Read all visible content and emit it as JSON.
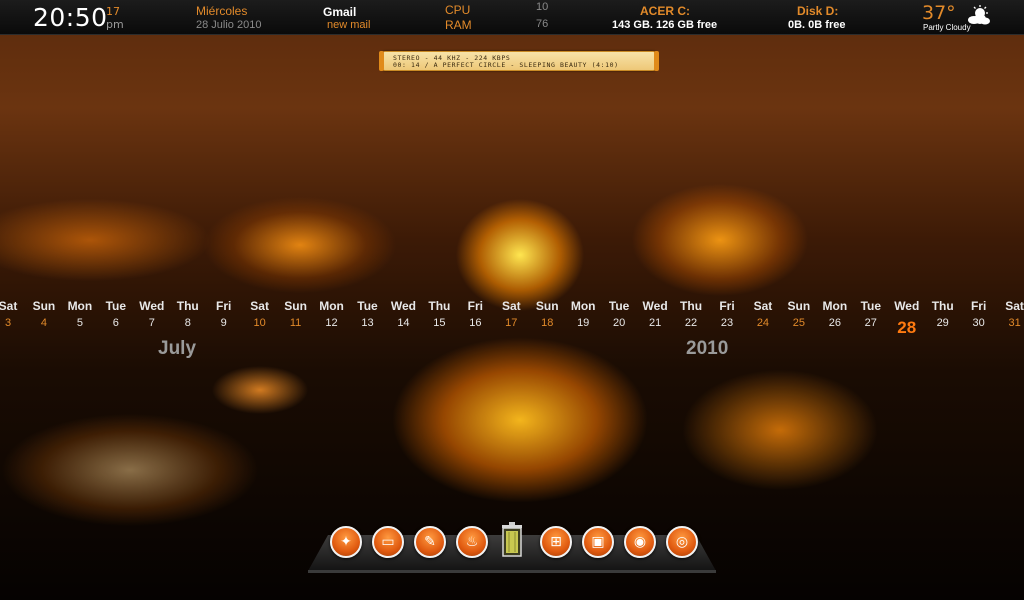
{
  "topbar": {
    "time": "20:50",
    "seconds": "17",
    "ampm": "pm",
    "day_name": "Miércoles",
    "date": "28 Julio 2010",
    "gmail_title": "Gmail",
    "gmail_status": "new mail",
    "cpu_label": "CPU",
    "cpu_value": "10",
    "ram_label": "RAM",
    "ram_value": "76",
    "acer_title": "ACER C:",
    "acer_info": "143 GB. 126 GB free",
    "diskd_title": "Disk D:",
    "diskd_info": "0B. 0B free",
    "temperature": "37°",
    "condition": "Partly Cloudy",
    "weather_icon": "partly-cloudy-icon"
  },
  "player": {
    "line1": "STEREO - 44 KHZ - 224 KBPS",
    "line2": "00: 14 / A PERFECT CIRCLE - SLEEPING BEAUTY (4:10)"
  },
  "calendar": {
    "month": "July",
    "year": "2010",
    "days": [
      {
        "name": "Sat",
        "num": "3",
        "weekend": true
      },
      {
        "name": "Sun",
        "num": "4",
        "weekend": true
      },
      {
        "name": "Mon",
        "num": "5"
      },
      {
        "name": "Tue",
        "num": "6"
      },
      {
        "name": "Wed",
        "num": "7"
      },
      {
        "name": "Thu",
        "num": "8"
      },
      {
        "name": "Fri",
        "num": "9"
      },
      {
        "name": "Sat",
        "num": "10",
        "weekend": true
      },
      {
        "name": "Sun",
        "num": "11",
        "weekend": true
      },
      {
        "name": "Mon",
        "num": "12"
      },
      {
        "name": "Tue",
        "num": "13"
      },
      {
        "name": "Wed",
        "num": "14"
      },
      {
        "name": "Thu",
        "num": "15"
      },
      {
        "name": "Fri",
        "num": "16"
      },
      {
        "name": "Sat",
        "num": "17",
        "weekend": true
      },
      {
        "name": "Sun",
        "num": "18",
        "weekend": true
      },
      {
        "name": "Mon",
        "num": "19"
      },
      {
        "name": "Tue",
        "num": "20"
      },
      {
        "name": "Wed",
        "num": "21"
      },
      {
        "name": "Thu",
        "num": "22"
      },
      {
        "name": "Fri",
        "num": "23"
      },
      {
        "name": "Sat",
        "num": "24",
        "weekend": true
      },
      {
        "name": "Sun",
        "num": "25",
        "weekend": true
      },
      {
        "name": "Mon",
        "num": "26"
      },
      {
        "name": "Tue",
        "num": "27"
      },
      {
        "name": "Wed",
        "num": "28",
        "today": true
      },
      {
        "name": "Thu",
        "num": "29"
      },
      {
        "name": "Fri",
        "num": "30"
      },
      {
        "name": "Sat",
        "num": "31",
        "weekend": true
      }
    ]
  },
  "dock": {
    "icons": [
      {
        "name": "paw-icon",
        "glyph": "✦"
      },
      {
        "name": "monitor-icon",
        "glyph": "▭"
      },
      {
        "name": "pencil-icon",
        "glyph": "✎"
      },
      {
        "name": "fire-icon",
        "glyph": "♨"
      },
      {
        "name": "cart-icon",
        "glyph": "⊞"
      },
      {
        "name": "truck-icon",
        "glyph": "▣"
      },
      {
        "name": "globe-icon",
        "glyph": "◉"
      },
      {
        "name": "disc-icon",
        "glyph": "◎"
      }
    ],
    "trash_icon": "trash-icon"
  },
  "colors": {
    "accent": "#e28a2a",
    "today": "#ff7a10"
  }
}
